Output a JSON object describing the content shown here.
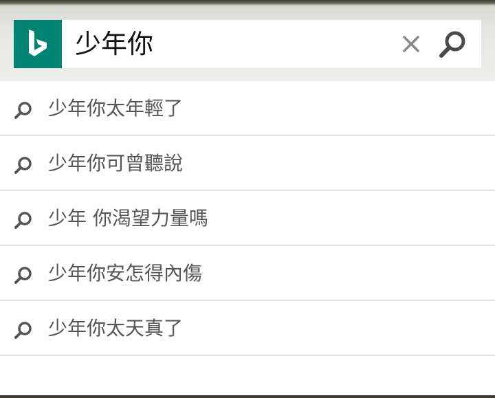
{
  "search": {
    "query": "少年你",
    "logo_icon": "bing-logo-icon",
    "clear_icon": "close-icon",
    "submit_icon": "search-icon"
  },
  "suggestions": [
    {
      "text": "少年你太年輕了",
      "icon": "search-icon"
    },
    {
      "text": "少年你可曾聽說",
      "icon": "search-icon"
    },
    {
      "text": "少年 你渴望力量嗎",
      "icon": "search-icon"
    },
    {
      "text": "少年你安怎得內傷",
      "icon": "search-icon"
    },
    {
      "text": "少年你太天真了",
      "icon": "search-icon"
    }
  ],
  "colors": {
    "brand": "#008373",
    "icon_gray": "#555555",
    "clear_gray": "#8a8a8a",
    "divider": "#dcdcdc"
  }
}
